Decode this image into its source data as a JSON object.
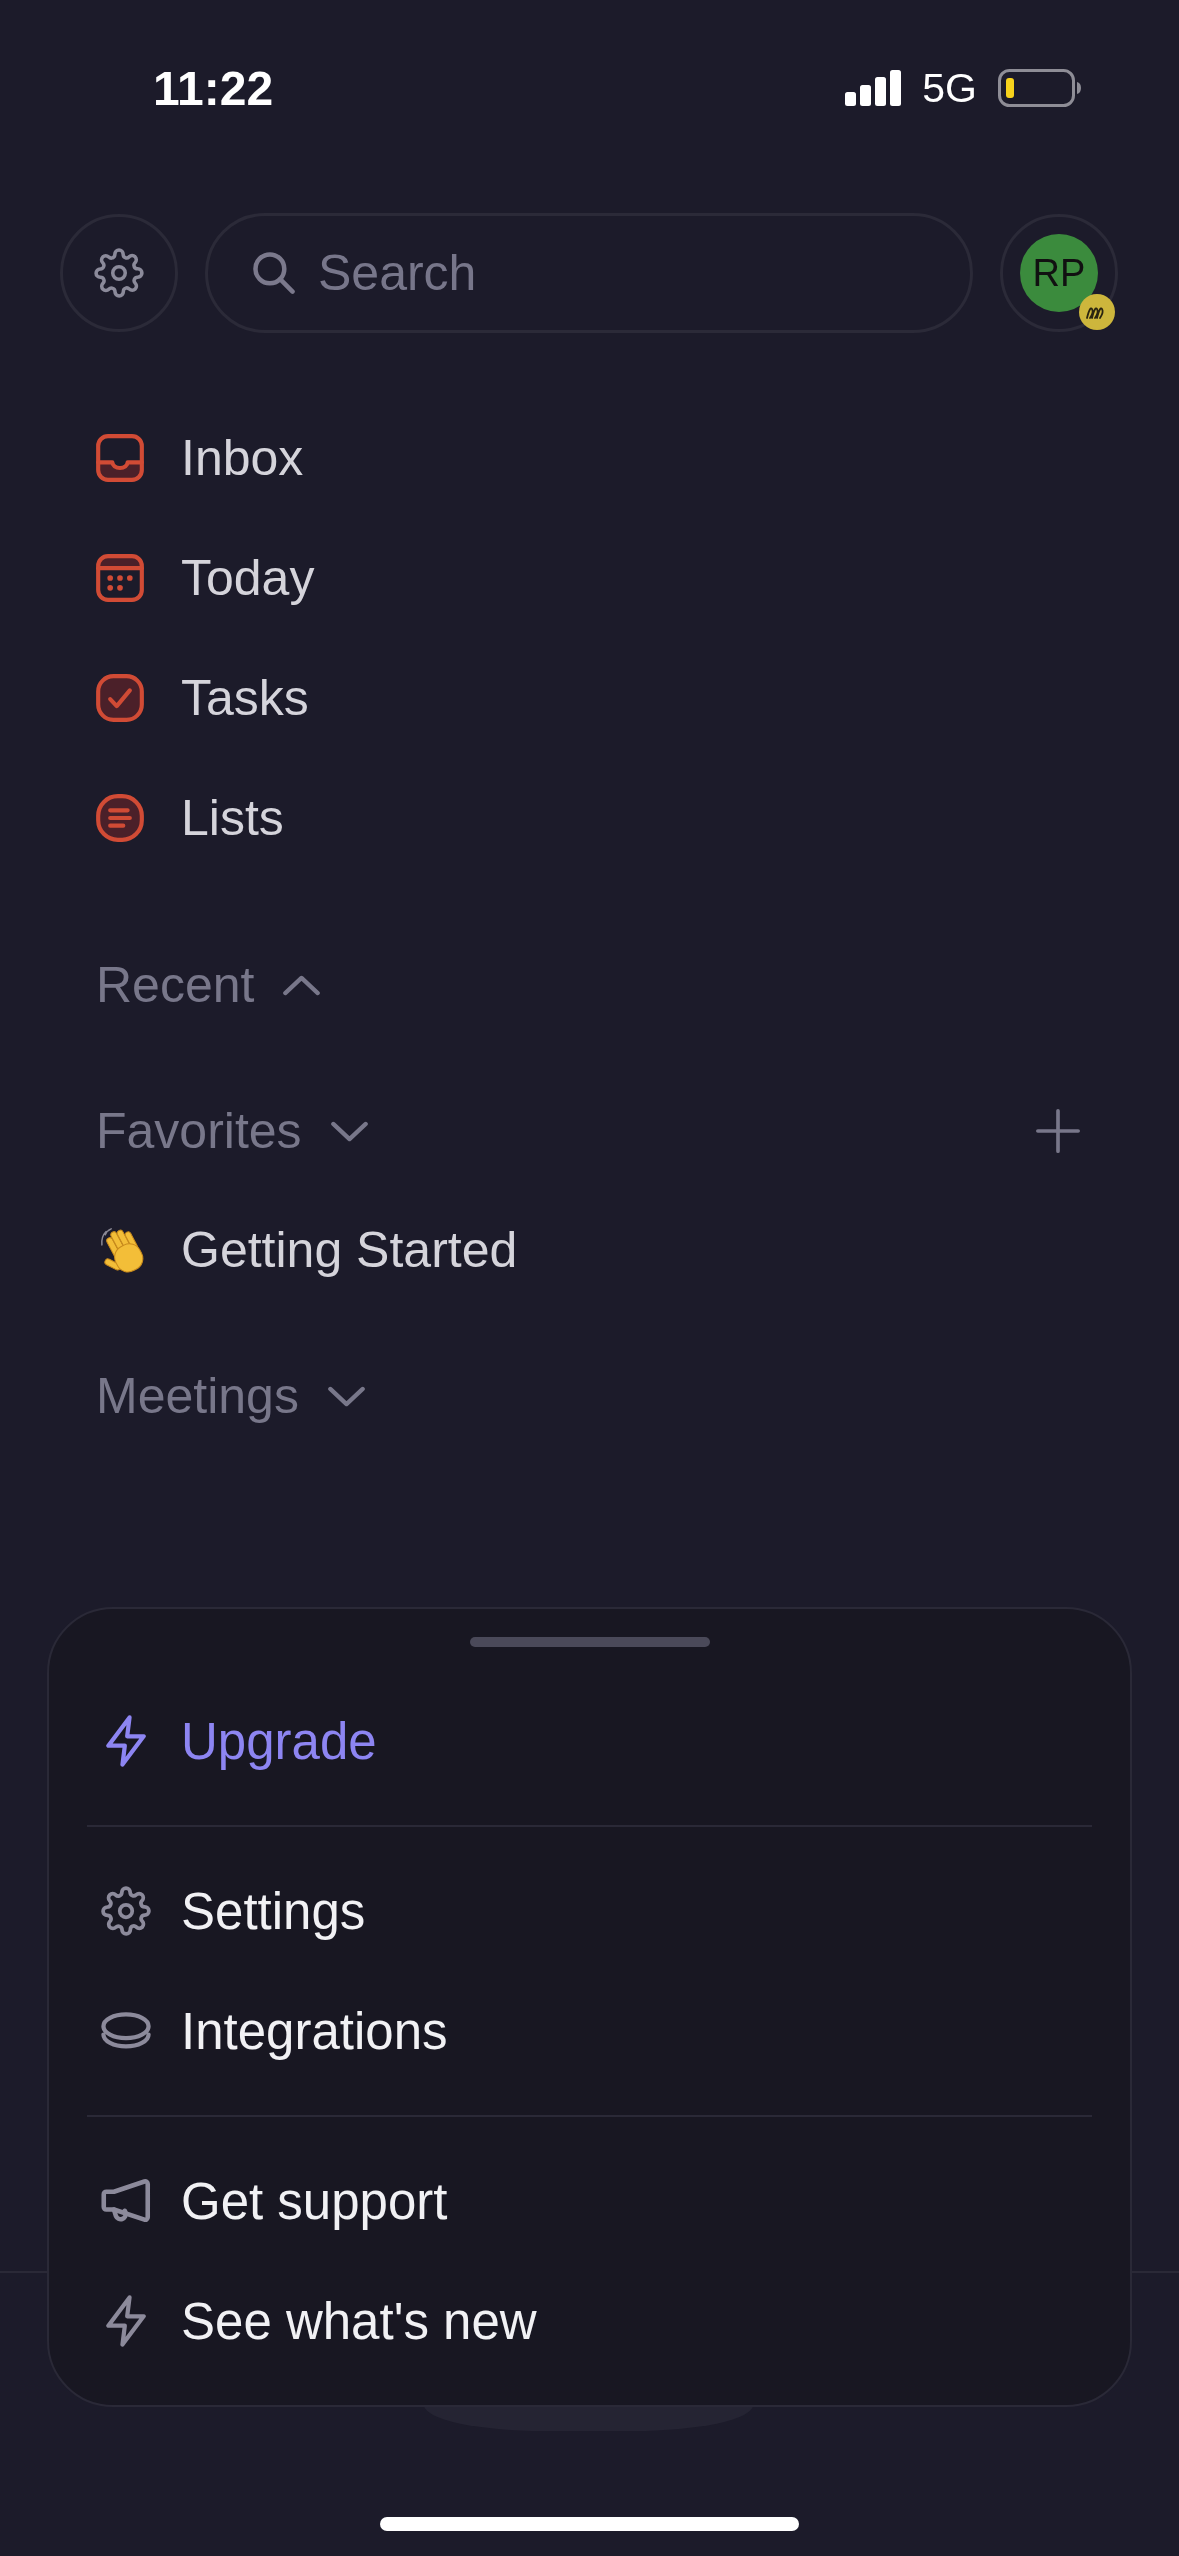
{
  "status_bar": {
    "time": "11:22",
    "network": "5G"
  },
  "header": {
    "search": {
      "placeholder": "Search"
    },
    "avatar": {
      "initials": "RP"
    }
  },
  "nav": [
    {
      "label": "Inbox"
    },
    {
      "label": "Today"
    },
    {
      "label": "Tasks"
    },
    {
      "label": "Lists"
    }
  ],
  "sections": [
    {
      "title": "Recent",
      "expanded": false,
      "has_add": false
    },
    {
      "title": "Favorites",
      "expanded": true,
      "has_add": true,
      "items": [
        {
          "label": "Getting Started"
        }
      ]
    },
    {
      "title": "Meetings",
      "expanded": true,
      "has_add": false
    }
  ],
  "sheet": {
    "groups": [
      [
        {
          "label": "Upgrade",
          "kind": "accent"
        }
      ],
      [
        {
          "label": "Settings",
          "kind": "plain"
        },
        {
          "label": "Integrations",
          "kind": "plain"
        }
      ],
      [
        {
          "label": "Get support",
          "kind": "plain"
        },
        {
          "label": "See what's new",
          "kind": "plain"
        }
      ]
    ]
  }
}
